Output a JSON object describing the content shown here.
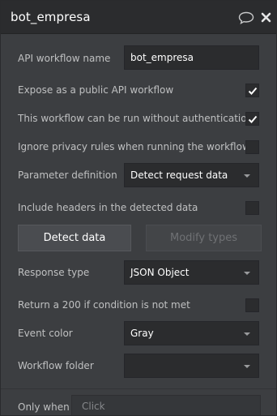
{
  "header": {
    "title": "bot_empresa"
  },
  "fields": {
    "api_workflow_name": {
      "label": "API workflow name",
      "value": "bot_empresa"
    },
    "expose_public": {
      "label": "Expose as a public API workflow",
      "checked": true
    },
    "no_auth": {
      "label": "This workflow can be run without authentication",
      "checked": true
    },
    "ignore_privacy": {
      "label": "Ignore privacy rules when running the workflow",
      "checked": false
    },
    "parameter_definition": {
      "label": "Parameter definition",
      "value": "Detect request data"
    },
    "include_headers": {
      "label": "Include headers in the detected data",
      "checked": false
    },
    "response_type": {
      "label": "Response type",
      "value": "JSON Object"
    },
    "return_200": {
      "label": "Return a 200 if condition is not met",
      "checked": false
    },
    "event_color": {
      "label": "Event color",
      "value": "Gray"
    },
    "workflow_folder": {
      "label": "Workflow folder",
      "value": ""
    }
  },
  "buttons": {
    "detect_data": "Detect data",
    "modify_types": "Modify types"
  },
  "footer": {
    "only_when_label": "Only when",
    "click_placeholder": "Click"
  },
  "colors": {
    "checkmark": "#ffffff",
    "header_bg": "#2b2c2e",
    "panel_bg": "#3c3e41"
  }
}
